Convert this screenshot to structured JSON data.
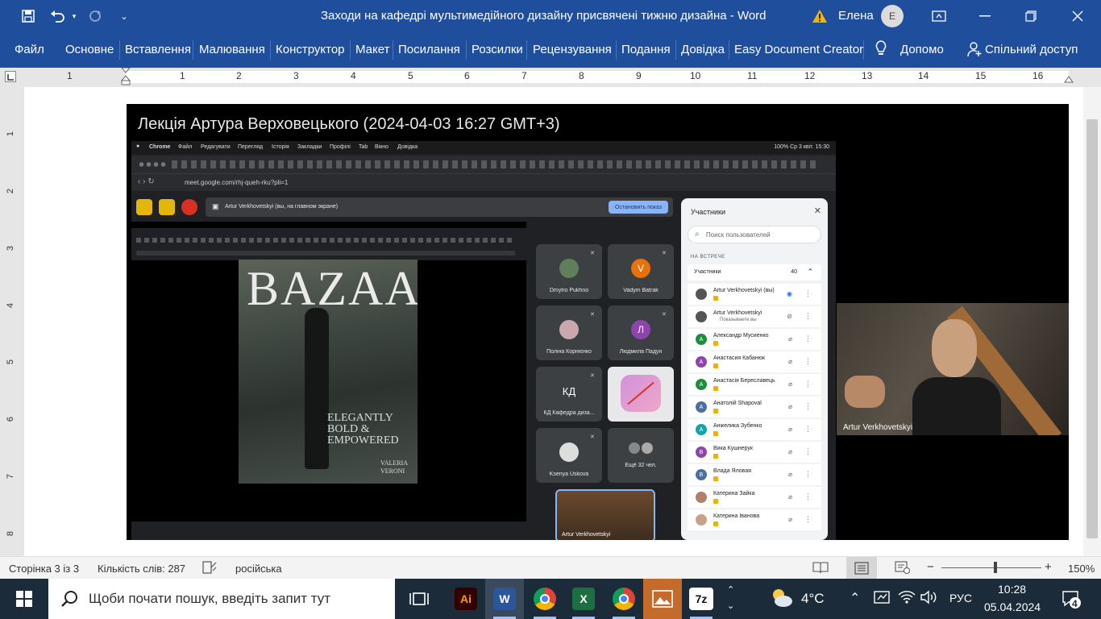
{
  "titlebar": {
    "title": "Заходи на кафедрі мультимедійного дизайну присвячені тижню дизайна  -  Word",
    "user": "Елена",
    "user_initial": "Е"
  },
  "ribbon": {
    "tabs": [
      "Файл",
      "Основне",
      "Вставлення",
      "Малювання",
      "Конструктор",
      "Макет",
      "Посилання",
      "Розсилки",
      "Рецензування",
      "Подання",
      "Довідка",
      "Easy Document Creator"
    ],
    "help_search": "Допомо",
    "share": "Спільний доступ"
  },
  "ruler": {
    "numbers": [
      "1",
      "1",
      "2",
      "3",
      "4",
      "5",
      "6",
      "7",
      "8",
      "9",
      "10",
      "11",
      "12",
      "13",
      "14",
      "15",
      "16"
    ],
    "vertical_numbers": [
      "1",
      "2",
      "3",
      "4",
      "5",
      "6",
      "7",
      "8"
    ]
  },
  "screenshot": {
    "lecture_title": "Лекція Артура Верховецького (2024-04-03 16:27 GMT+3)",
    "mac_menu": [
      "Chrome",
      "Файл",
      "Редагувати",
      "Перегляд",
      "Історія",
      "Закладки",
      "Профілі",
      "Tab",
      "Вікно",
      "Довідка"
    ],
    "mac_status": "100%   Ср 3 квіт.  15:30",
    "url": "meet.google.com/rhj-queh-rku?pli=1",
    "share_text": "Artur Verkhovetskyi (вы, на главном экране)",
    "stop_button": "Остановить показ",
    "magazine": {
      "title": "BAZAAR",
      "tagline": "ELEGANTLY BOLD & EMPOWERED",
      "name": "VALERIA VERONI"
    },
    "tiles": [
      {
        "name": "Dmytro Pukhno",
        "initial": "",
        "color": "#5f7f5a"
      },
      {
        "name": "Vadym Batrak",
        "initial": "V",
        "color": "#e8710a"
      },
      {
        "name": "Поліна Корнієнко",
        "initial": "",
        "color": "#c9a8b0"
      },
      {
        "name": "Людмила Падун",
        "initial": "Л",
        "color": "#8e44ad"
      },
      {
        "name": "КД Кафедра диза...",
        "initial": "КД",
        "color": "#3c4043"
      },
      {
        "name": "Ksenya Uskova",
        "initial": "",
        "color": "#ddd"
      },
      {
        "name": "Ещё 32 чел.",
        "initial": "",
        "color": "#777"
      }
    ],
    "self_view_name": "Artur Verkhovetskyi",
    "panel": {
      "title": "Участники",
      "search_placeholder": "Поиск пользователей",
      "section": "НА ВСТРЕЧЕ",
      "group_label": "Участники",
      "group_count": "40",
      "participants": [
        {
          "name": "Artur Verkhovetskyi (вы)",
          "initial": "",
          "color": "#555"
        },
        {
          "name": "Artur Verkhovetskyi",
          "sub": "Показываете вы",
          "initial": "",
          "color": "#555"
        },
        {
          "name": "Александр Мусиенко",
          "initial": "А",
          "color": "#1e8e3e"
        },
        {
          "name": "Анастасия Кабанюк",
          "initial": "А",
          "color": "#8e44ad"
        },
        {
          "name": "Анастасія Береславець",
          "initial": "А",
          "color": "#1e8e3e"
        },
        {
          "name": "Анатолій Shapoval",
          "initial": "А",
          "color": "#4a6fa5"
        },
        {
          "name": "Анжелика Зубенко",
          "initial": "А",
          "color": "#12a4a8"
        },
        {
          "name": "Вика Кушнерук",
          "initial": "В",
          "color": "#8e44ad"
        },
        {
          "name": "Влада Яловая",
          "initial": "В",
          "color": "#4a6fa5"
        },
        {
          "name": "Катерина Зайка",
          "initial": "",
          "color": "#b0806a"
        },
        {
          "name": "Катерина Іванова",
          "initial": "",
          "color": "#c9a08a"
        }
      ]
    },
    "camera_name": "Artur Verkhovetskyi"
  },
  "status": {
    "page": "Сторінка 3 із 3",
    "words": "Кількість слів: 287",
    "language": "російська",
    "zoom": "150%"
  },
  "taskbar": {
    "search_placeholder": "Щоби почати пошук, введіть запит тут",
    "temperature": "4°C",
    "language": "РУС",
    "time": "10:28",
    "date": "05.04.2024",
    "notifications": "4",
    "apps": [
      "task-view",
      "illustrator",
      "word",
      "chrome-fd",
      "excel",
      "chrome-p",
      "photos",
      "7zip"
    ]
  }
}
